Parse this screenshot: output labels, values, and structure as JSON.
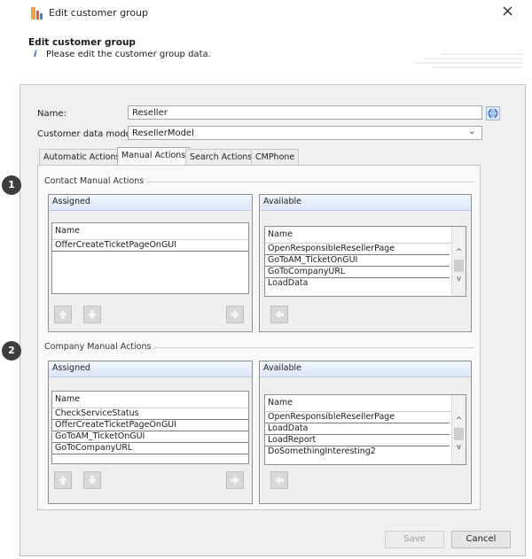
{
  "window": {
    "title": "Edit customer group",
    "close_glyph": "×"
  },
  "header": {
    "title": "Edit customer group",
    "info_glyph": "i",
    "description": "Please edit the customer group data."
  },
  "form": {
    "name_label": "Name:",
    "name_value": "Reseller",
    "model_label": "Customer data model:",
    "model_value": "ResellerModel",
    "dropdown_glyph": "⌄"
  },
  "tabs": [
    {
      "label": "Automatic Actions"
    },
    {
      "label": "Manual Actions"
    },
    {
      "label": "Search Actions"
    },
    {
      "label": "CMPhone"
    }
  ],
  "groups": [
    {
      "badge": "1",
      "title": "Contact Manual Actions",
      "assigned": {
        "title": "Assigned",
        "column": "Name",
        "rows": [
          "OfferCreateTicketPageOnGUI"
        ]
      },
      "available": {
        "title": "Available",
        "column": "Name",
        "rows": [
          "OpenResponsibleResellerPage",
          "GoToAM_TicketOnGUI",
          "GoToCompanyURL",
          "LoadData"
        ]
      }
    },
    {
      "badge": "2",
      "title": "Company Manual Actions",
      "assigned": {
        "title": "Assigned",
        "column": "Name",
        "rows": [
          "CheckServiceStatus",
          "OfferCreateTicketPageOnGUI",
          "GoToAM_TicketOnGUI",
          "GoToCompanyURL"
        ]
      },
      "available": {
        "title": "Available",
        "column": "Name",
        "rows": [
          "OpenResponsibleResellerPage",
          "LoadData",
          "LoadReport",
          "DoSomethingInteresting2"
        ]
      }
    }
  ],
  "footer": {
    "save_label": "Save",
    "cancel_label": "Cancel"
  },
  "icons": {
    "app": "app-icon",
    "info": "info-icon",
    "globe": "globe-icon",
    "up": "arrow-up-icon",
    "down": "arrow-down-icon",
    "right": "arrow-right-icon",
    "left": "arrow-left-icon"
  },
  "colors": {
    "accent": "#3a66b3",
    "panel_header": "#dbe7fa",
    "badge": "#3d3d3d"
  }
}
